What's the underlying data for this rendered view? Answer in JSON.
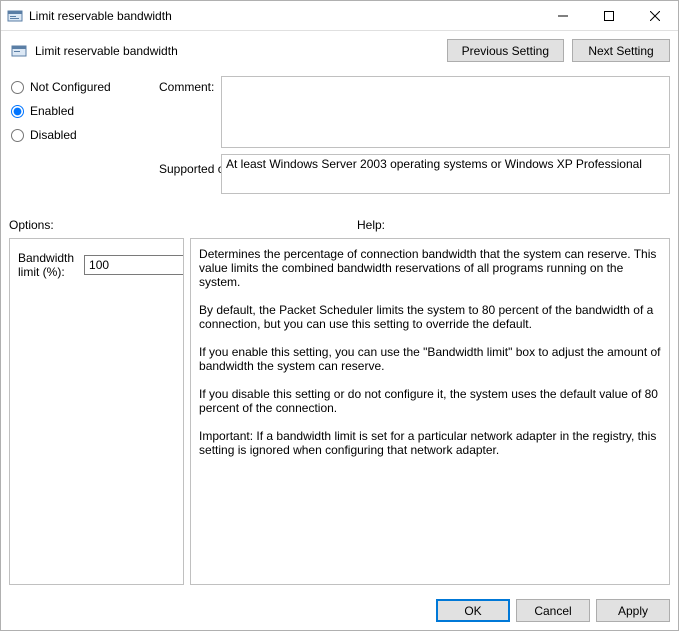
{
  "window": {
    "title": "Limit reservable bandwidth"
  },
  "header": {
    "policy_name": "Limit reservable bandwidth",
    "previous_btn": "Previous Setting",
    "next_btn": "Next Setting"
  },
  "state": {
    "not_configured": "Not Configured",
    "enabled": "Enabled",
    "disabled": "Disabled",
    "selected": "enabled"
  },
  "labels": {
    "comment": "Comment:",
    "supported_on": "Supported on:",
    "options": "Options:",
    "help": "Help:"
  },
  "fields": {
    "comment_value": "",
    "supported_value": "At least Windows Server 2003 operating systems or Windows XP Professional"
  },
  "options": {
    "bandwidth_label": "Bandwidth limit (%):",
    "bandwidth_value": "100"
  },
  "help": {
    "p1": "Determines the percentage of connection bandwidth that the system can reserve. This value limits the combined bandwidth reservations of all programs running on the system.",
    "p2": "By default, the Packet Scheduler limits the system to 80 percent of the bandwidth of a connection, but you can use this setting to override the default.",
    "p3": "If you enable this setting, you can use the \"Bandwidth limit\" box to adjust the amount of bandwidth the system can reserve.",
    "p4": "If you disable this setting or do not configure it, the system uses the default value of 80 percent of the connection.",
    "p5": "Important: If a bandwidth limit is set for a particular network adapter in the registry, this setting is ignored when configuring that network adapter."
  },
  "footer": {
    "ok": "OK",
    "cancel": "Cancel",
    "apply": "Apply"
  }
}
